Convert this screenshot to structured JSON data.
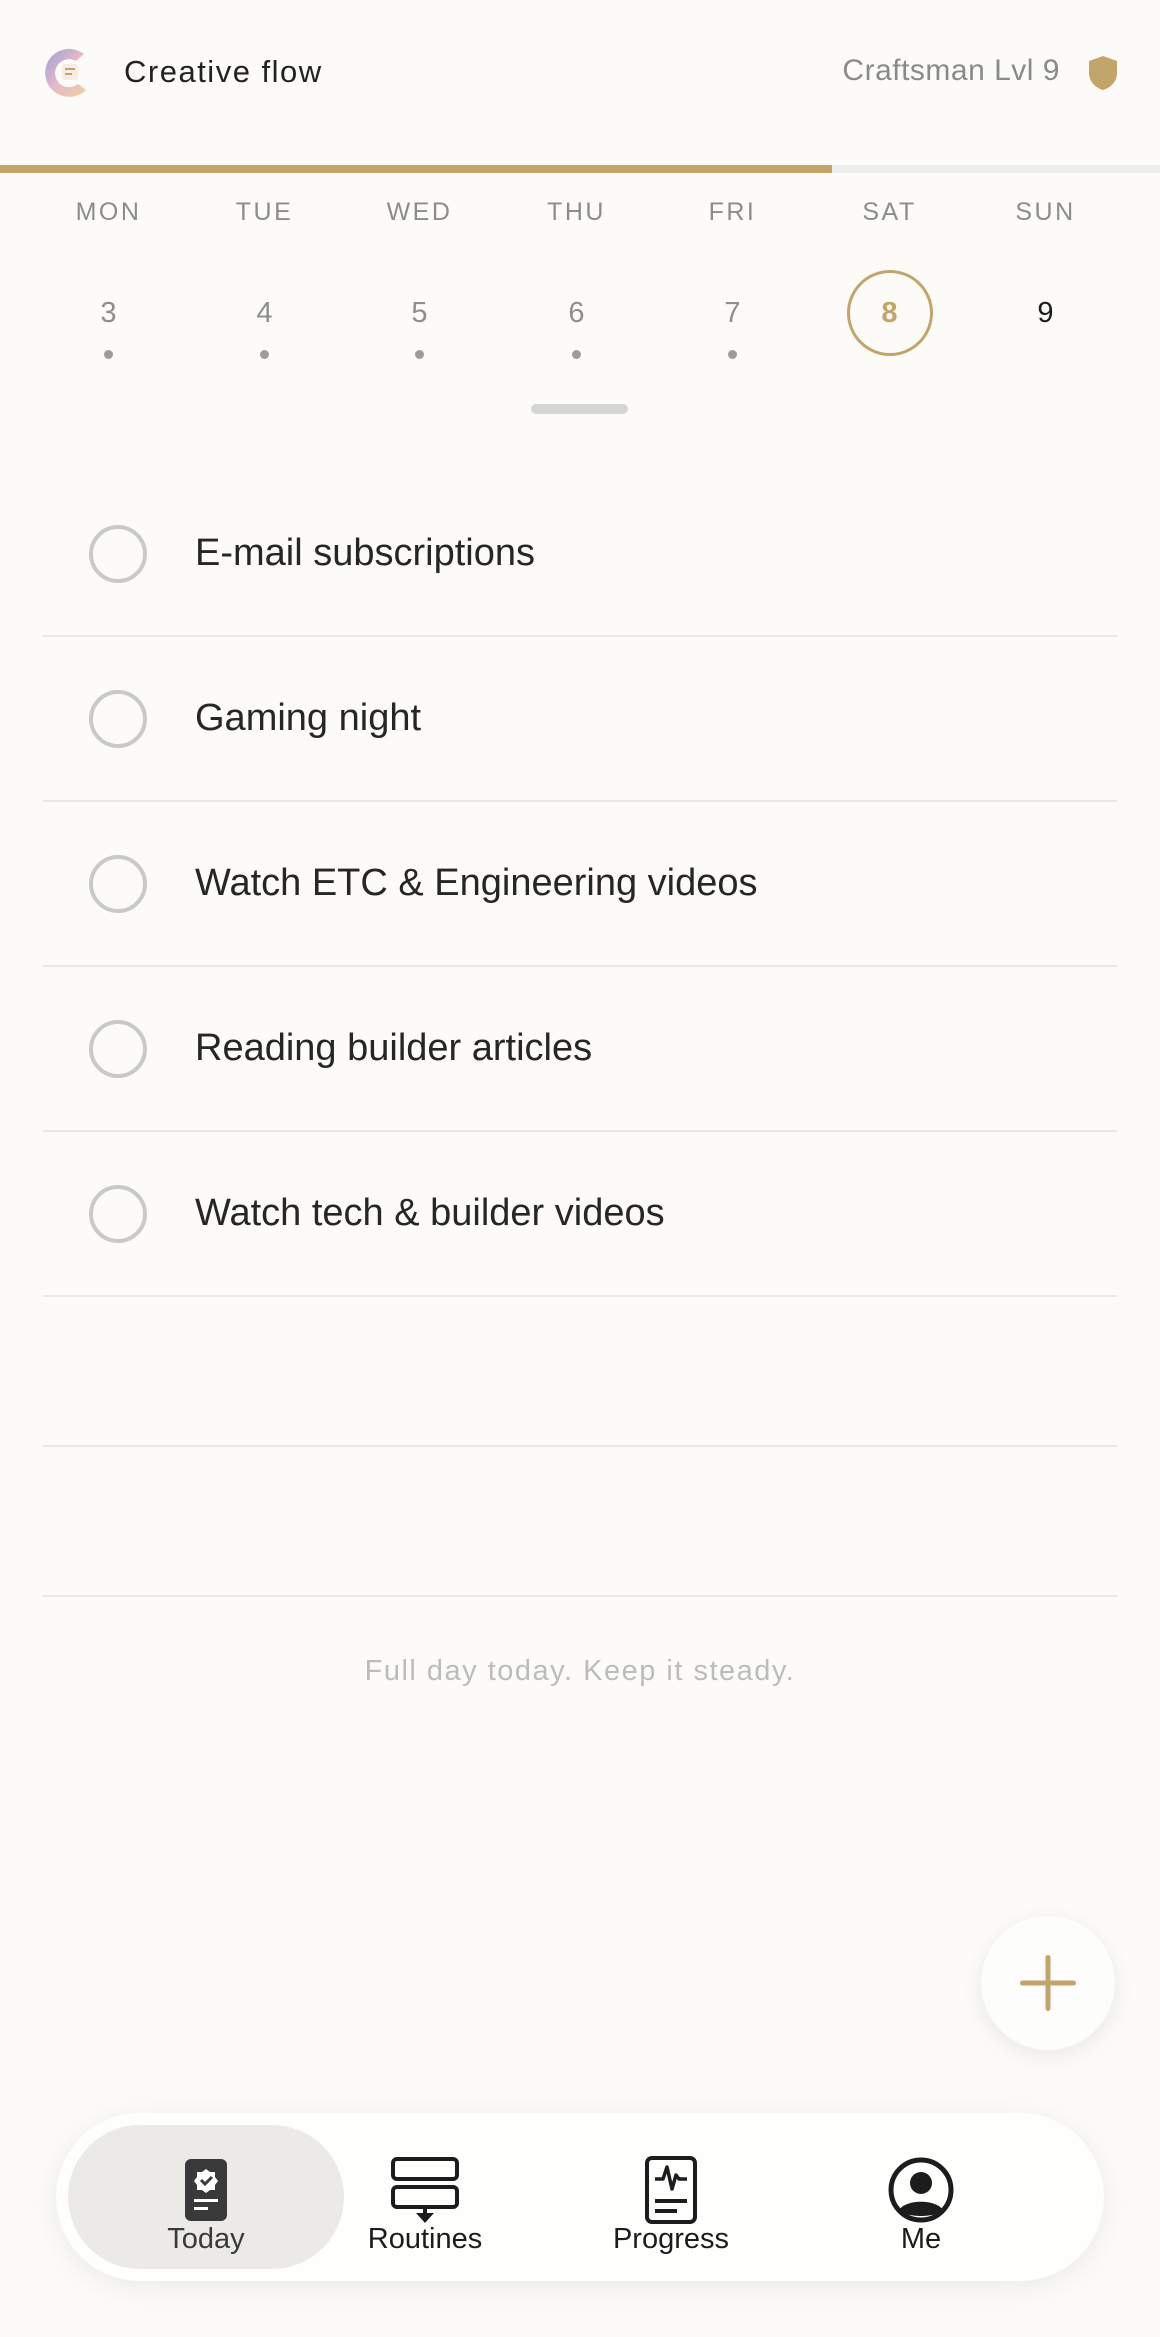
{
  "header": {
    "app_title": "Creative flow",
    "level_label": "Craftsman Lvl 9",
    "logo_icon": "app-logo-icon",
    "badge_icon": "shield-badge-icon"
  },
  "progress": {
    "value_percent": 71.7,
    "color": "#c3a46a"
  },
  "week": {
    "days": [
      {
        "name": "MON",
        "num": "3",
        "has_dot": true,
        "state": "past"
      },
      {
        "name": "TUE",
        "num": "4",
        "has_dot": true,
        "state": "past"
      },
      {
        "name": "WED",
        "num": "5",
        "has_dot": true,
        "state": "past"
      },
      {
        "name": "THU",
        "num": "6",
        "has_dot": true,
        "state": "past"
      },
      {
        "name": "FRI",
        "num": "7",
        "has_dot": true,
        "state": "past"
      },
      {
        "name": "SAT",
        "num": "8",
        "has_dot": false,
        "state": "selected"
      },
      {
        "name": "SUN",
        "num": "9",
        "has_dot": false,
        "state": "future"
      }
    ]
  },
  "tasks": [
    {
      "label": "E-mail subscriptions",
      "done": false
    },
    {
      "label": "Gaming night",
      "done": false
    },
    {
      "label": "Watch ETC & Engineering videos",
      "done": false
    },
    {
      "label": "Reading builder articles",
      "done": false
    },
    {
      "label": "Watch tech & builder videos",
      "done": false
    }
  ],
  "footer_message": "Full day today. Keep it steady.",
  "fab": {
    "icon": "plus-icon"
  },
  "nav": {
    "items": [
      {
        "label": "Today",
        "icon": "today-clipboard-icon",
        "active": true
      },
      {
        "label": "Routines",
        "icon": "routines-stack-icon",
        "active": false
      },
      {
        "label": "Progress",
        "icon": "progress-report-icon",
        "active": false
      },
      {
        "label": "Me",
        "icon": "profile-avatar-icon",
        "active": false
      }
    ]
  },
  "colors": {
    "accent": "#c3a46a",
    "background": "#fcfbf8",
    "text": "#262626",
    "muted": "#8c8c8c"
  }
}
